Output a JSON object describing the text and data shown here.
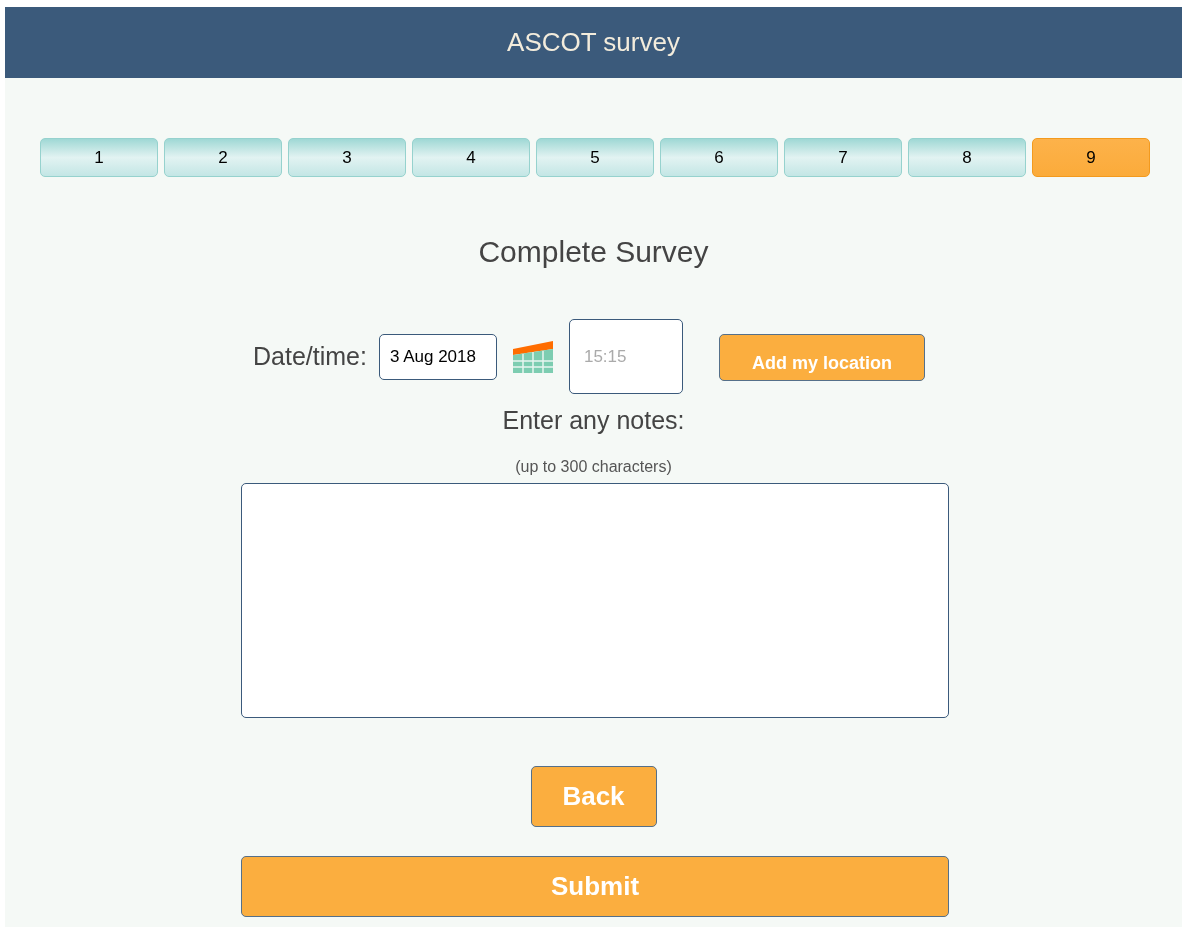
{
  "header": {
    "title": "ASCOT survey"
  },
  "steps": [
    {
      "label": "1",
      "selected": false
    },
    {
      "label": "2",
      "selected": false
    },
    {
      "label": "3",
      "selected": false
    },
    {
      "label": "4",
      "selected": false
    },
    {
      "label": "5",
      "selected": false
    },
    {
      "label": "6",
      "selected": false
    },
    {
      "label": "7",
      "selected": false
    },
    {
      "label": "8",
      "selected": false
    },
    {
      "label": "9",
      "selected": true
    }
  ],
  "heading": "Complete Survey",
  "datetime": {
    "label": "Date/time:",
    "date": "3 Aug 2018",
    "time_placeholder": "15:15",
    "location_button": "Add my location"
  },
  "notes": {
    "label": "Enter any notes:",
    "hint": "(up to 300 characters)"
  },
  "buttons": {
    "back": "Back",
    "submit": "Submit"
  }
}
